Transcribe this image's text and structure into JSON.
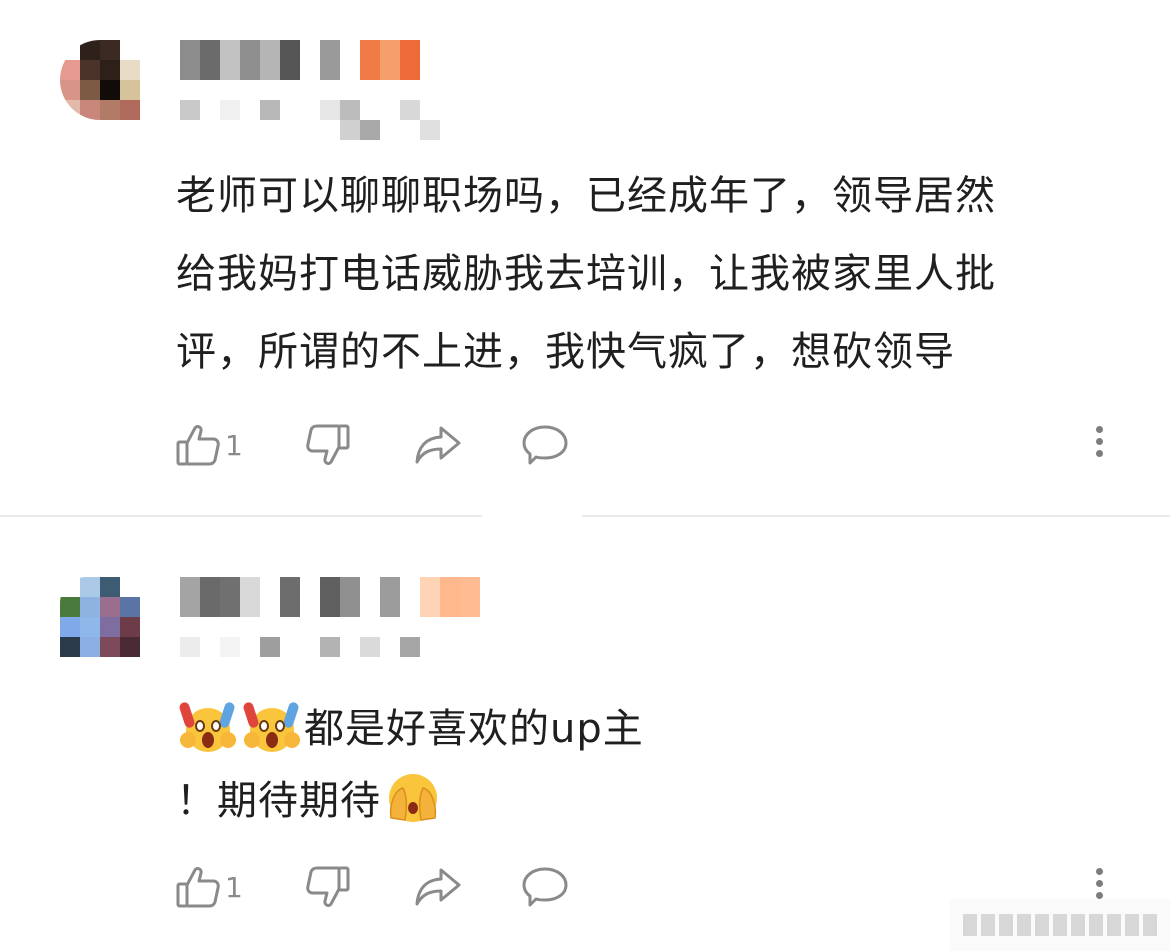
{
  "comments": [
    {
      "author_masked": "",
      "lines": [
        "老师可以聊聊职场吗，已经成年了，领导居然",
        "给我妈打电话威胁我去培训，让我被家里人批",
        "评，所谓的不上进，我快气疯了，想砍领导"
      ],
      "likes": "1"
    },
    {
      "author_masked": "",
      "line1": "都是好喜欢的up主",
      "line2": "！期待期待",
      "likes": "1"
    }
  ],
  "icons": [
    "thumbs-up-icon",
    "thumbs-down-icon",
    "share-icon",
    "reply-bubble-icon",
    "more-vertical-icon"
  ],
  "colors": {
    "text": "#1f1f1f",
    "icon": "#8a8a8a",
    "divider": "#e9e9e9",
    "name_accent": "#f07b46"
  }
}
